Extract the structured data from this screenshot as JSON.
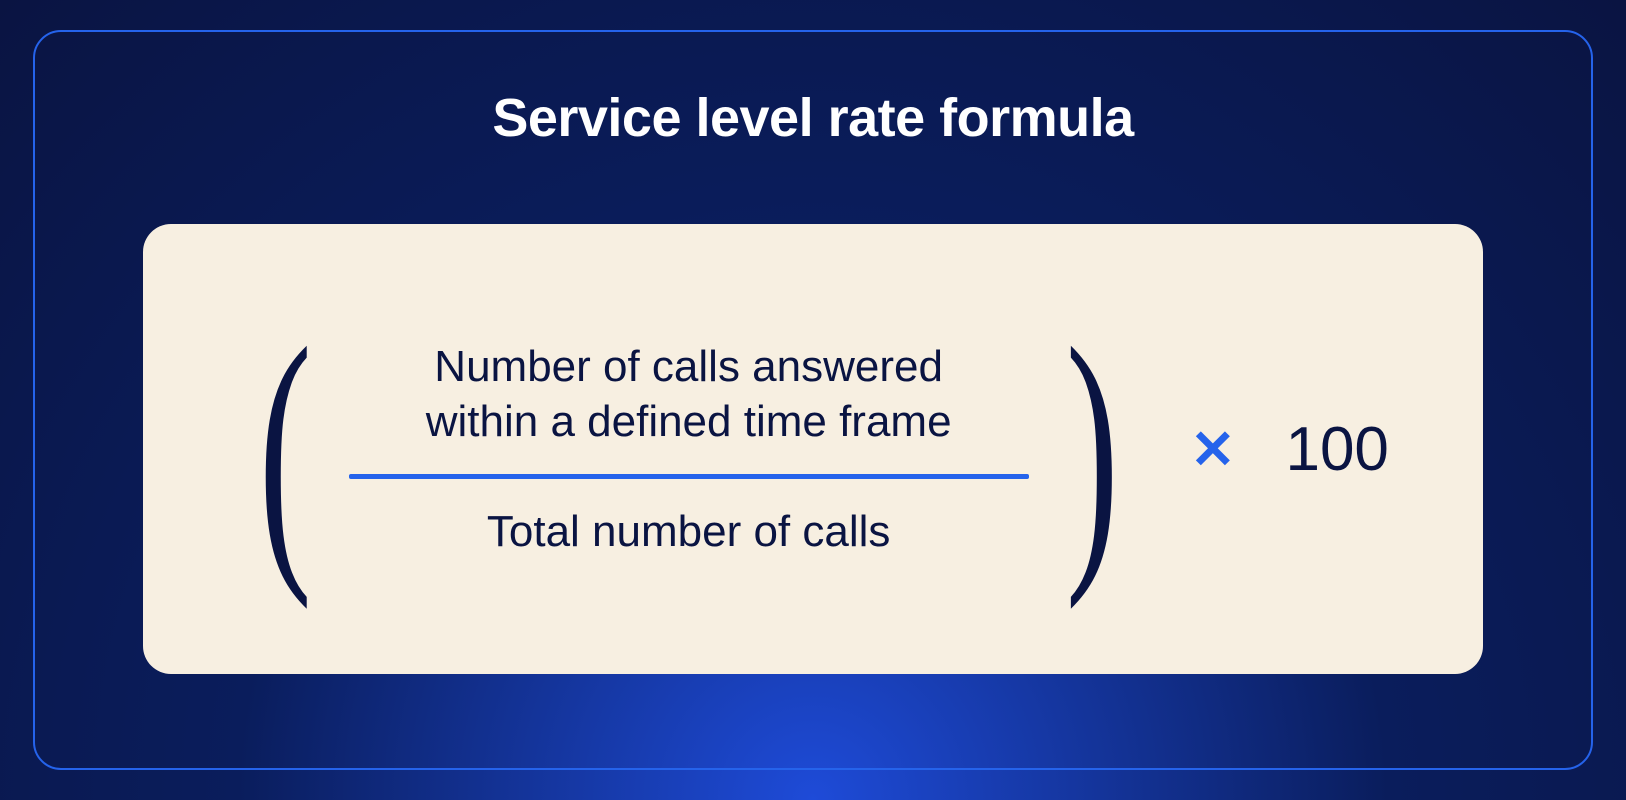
{
  "title": "Service level rate formula",
  "formula": {
    "numerator": "Number of calls answered\nwithin a defined time frame",
    "denominator": "Total number of calls",
    "multiplier": "100"
  }
}
